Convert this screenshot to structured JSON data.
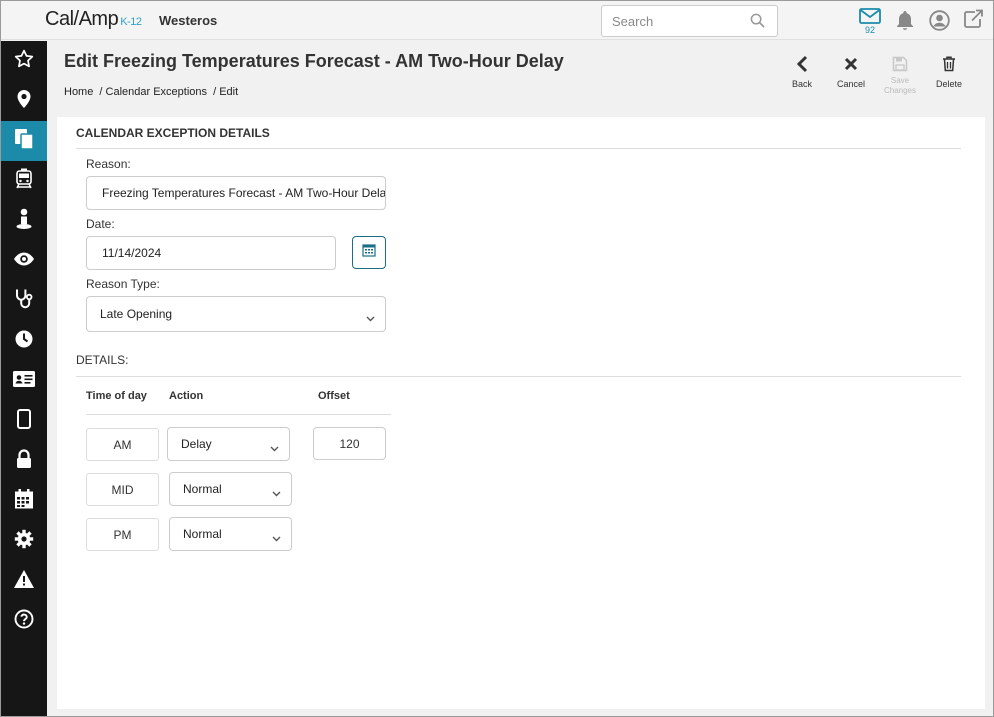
{
  "app": {
    "logo_text": "Cal/Amp",
    "logo_suffix": "K-12",
    "org_name": "Westeros",
    "mail_count": "92"
  },
  "search": {
    "placeholder": "Search",
    "value": ""
  },
  "sidebar": {
    "items": [
      {
        "icon": "star-icon"
      },
      {
        "icon": "map-pin-icon"
      },
      {
        "icon": "documents-icon",
        "active": true
      },
      {
        "icon": "bus-icon"
      },
      {
        "icon": "person-icon"
      },
      {
        "icon": "eye-icon"
      },
      {
        "icon": "stethoscope-icon"
      },
      {
        "icon": "clock-icon"
      },
      {
        "icon": "id-card-icon"
      },
      {
        "icon": "tablet-icon"
      },
      {
        "icon": "lock-icon"
      },
      {
        "icon": "calendar-icon"
      },
      {
        "icon": "gear-icon"
      },
      {
        "icon": "warning-icon"
      },
      {
        "icon": "help-icon"
      }
    ]
  },
  "header": {
    "title": "Edit Freezing Temperatures Forecast - AM Two-Hour Delay",
    "breadcrumb": [
      "Home",
      "/ Calendar Exceptions",
      "/ Edit"
    ]
  },
  "toolbar": {
    "back": "Back",
    "cancel": "Cancel",
    "save_line1": "Save",
    "save_line2": "Changes",
    "delete": "Delete"
  },
  "form": {
    "section_title": "CALENDAR EXCEPTION DETAILS",
    "reason_label": "Reason:",
    "reason_value": "Freezing Temperatures Forecast - AM Two-Hour Delay",
    "date_label": "Date:",
    "date_value": "11/14/2024",
    "reason_type_label": "Reason Type:",
    "reason_type_value": "Late Opening"
  },
  "details": {
    "label": "DETAILS:",
    "columns": [
      "Time of day",
      "Action",
      "Offset"
    ],
    "rows": [
      {
        "time": "AM",
        "action": "Delay",
        "offset": "120"
      },
      {
        "time": "MID",
        "action": "Normal"
      },
      {
        "time": "PM",
        "action": "Normal"
      }
    ]
  },
  "colors": {
    "accent": "#1b8ba9",
    "sidebar": "#161616"
  }
}
